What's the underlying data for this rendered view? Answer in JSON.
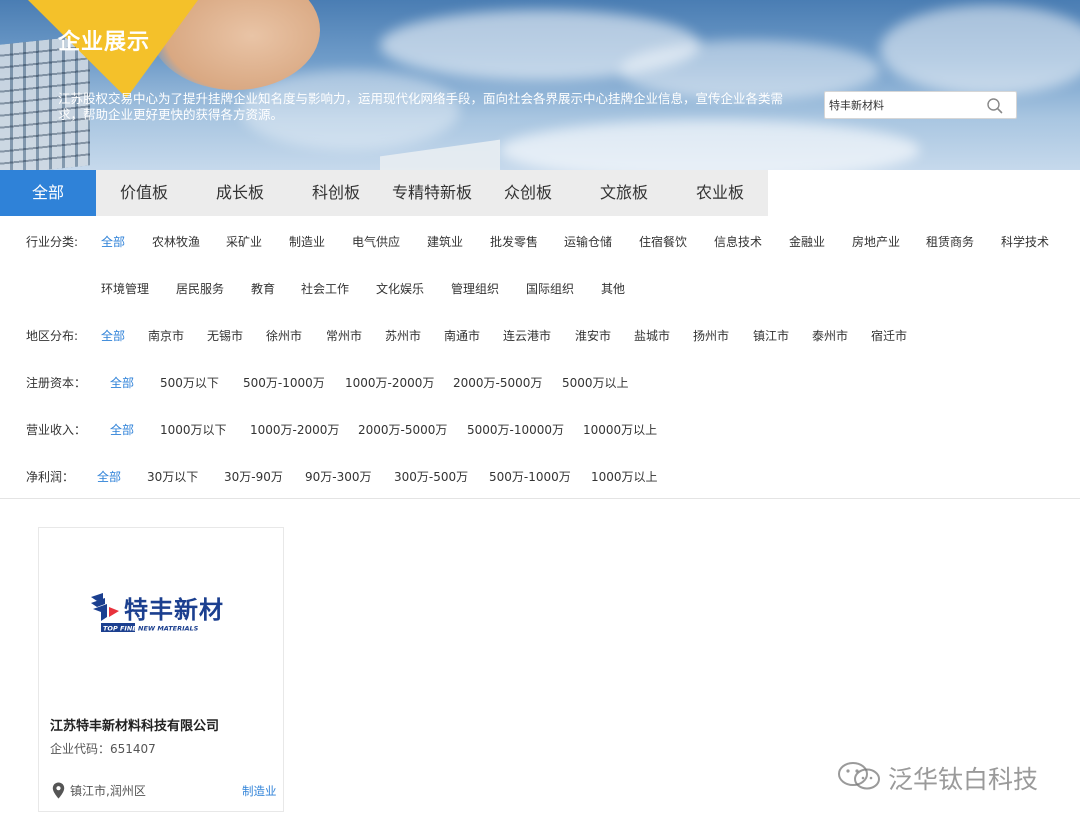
{
  "banner": {
    "title": "企业展示",
    "description": "江苏股权交易中心为了提升挂牌企业知名度与影响力，运用现代化网络手段，面向社会各界展示中心挂牌企业信息，宣传企业各类需求，帮助企业更好更快的获得各方资源。",
    "search": {
      "value": "特丰新材料"
    }
  },
  "tabs": [
    "全部",
    "价值板",
    "成长板",
    "科创板",
    "专精特新板",
    "众创板",
    "文旅板",
    "农业板"
  ],
  "active_tab": "全部",
  "filters": {
    "industry": {
      "label": "行业分类:",
      "options": [
        "全部",
        "农林牧渔",
        "采矿业",
        "制造业",
        "电气供应",
        "建筑业",
        "批发零售",
        "运输仓储",
        "住宿餐饮",
        "信息技术",
        "金融业",
        "房地产业",
        "租赁商务",
        "科学技术",
        "环境管理",
        "居民服务",
        "教育",
        "社会工作",
        "文化娱乐",
        "管理组织",
        "国际组织",
        "其他"
      ]
    },
    "region": {
      "label": "地区分布:",
      "options": [
        "全部",
        "南京市",
        "无锡市",
        "徐州市",
        "常州市",
        "苏州市",
        "南通市",
        "连云港市",
        "淮安市",
        "盐城市",
        "扬州市",
        "镇江市",
        "泰州市",
        "宿迁市"
      ]
    },
    "capital": {
      "label": "注册资本：",
      "options": [
        "全部",
        "500万以下",
        "500万-1000万",
        "1000万-2000万",
        "2000万-5000万",
        "5000万以上"
      ]
    },
    "revenue": {
      "label": "营业收入：",
      "options": [
        "全部",
        "1000万以下",
        "1000万-2000万",
        "2000万-5000万",
        "5000万-10000万",
        "10000万以上"
      ]
    },
    "profit": {
      "label": "净利润：",
      "options": [
        "全部",
        "30万以下",
        "30万-90万",
        "90万-300万",
        "300万-500万",
        "500万-1000万",
        "1000万以上"
      ]
    }
  },
  "company": {
    "logo_cn": "特丰新材",
    "logo_en_left": "TOP FINE",
    "logo_en_right": "NEW MATERIALS",
    "name": "江苏特丰新材料科技有限公司",
    "code": "企业代码：651407",
    "location": "镇江市,润州区",
    "industry": "制造业"
  },
  "watermark": {
    "text": "泛华钛白科技"
  },
  "colors": {
    "accent": "#2f82d8",
    "tab_bg": "#ececec",
    "logo_blue": "#1b3f8f",
    "banner_yellow": "#f4c12a"
  }
}
